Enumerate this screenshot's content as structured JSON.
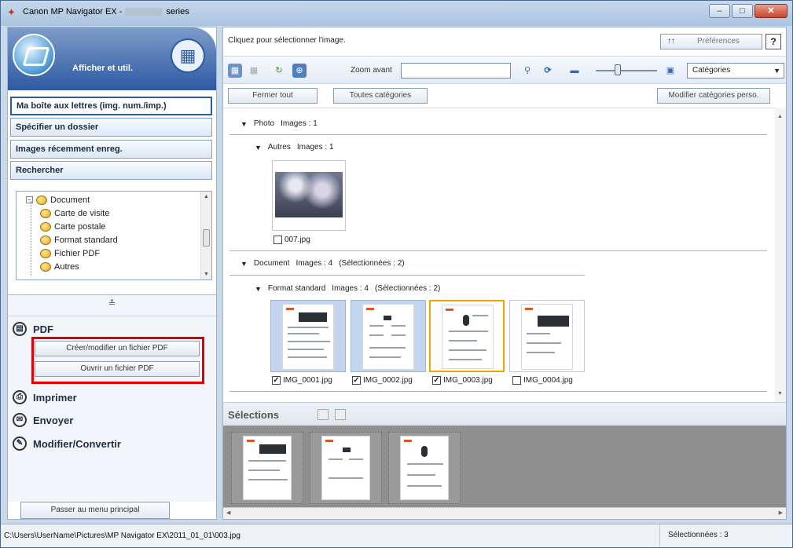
{
  "window": {
    "title_prefix": "Canon MP Navigator EX - ",
    "title_suffix": "series",
    "minimize": "–",
    "maximize": "□",
    "close": "✕"
  },
  "left": {
    "header_label": "Afficher et util.",
    "nav": [
      "Ma boîte aux lettres (img. num./imp.)",
      "Spécifier un dossier",
      "Images récemment enreg.",
      "Rechercher"
    ],
    "tree": [
      "Document",
      "Carte de visite",
      "Carte postale",
      "Format standard",
      "Fichier PDF",
      "Autres"
    ],
    "collapse_glyph": "≚",
    "tasks": {
      "pdf": "PDF",
      "pdf_create": "Créer/modifier un fichier PDF",
      "pdf_open": "Ouvrir un fichier PDF",
      "print": "Imprimer",
      "send": "Envoyer",
      "edit": "Modifier/Convertir"
    },
    "main_menu": "Passer au menu principal"
  },
  "right": {
    "hint": "Cliquez pour sélectionner l'image.",
    "preferences": "Préférences",
    "preferences_arrows": "↑↑",
    "help": "?",
    "zoom_in": "Zoom avant",
    "search_value": "",
    "category_select": "Catégories",
    "close_all": "Fermer tout",
    "all_categories": "Toutes catégories",
    "edit_categories": "Modifier catégories perso.",
    "groups": {
      "photo": "Photo",
      "photo_count": "Images : 1",
      "autres": "Autres",
      "autres_count": "Images : 1",
      "document": "Document",
      "document_count": "Images : 4",
      "document_sel": "(Sélectionnées : 2)",
      "format": "Format standard",
      "format_count": "Images : 4",
      "format_sel": "(Sélectionnées : 2)"
    },
    "files": {
      "f007": "007.jpg",
      "f1": "IMG_0001.jpg",
      "f2": "IMG_0002.jpg",
      "f3": "IMG_0003.jpg",
      "f4": "IMG_0004.jpg"
    },
    "selections_title": "Sélections"
  },
  "status": {
    "path": "C:\\Users\\UserName\\Pictures\\MP Navigator EX\\2011_01_01\\003.jpg",
    "selected": "Sélectionnées : 3"
  },
  "colors": {
    "highlight_box": "#e00000",
    "current_frame": "#f0a800",
    "header_blue": "#2d59a3"
  }
}
